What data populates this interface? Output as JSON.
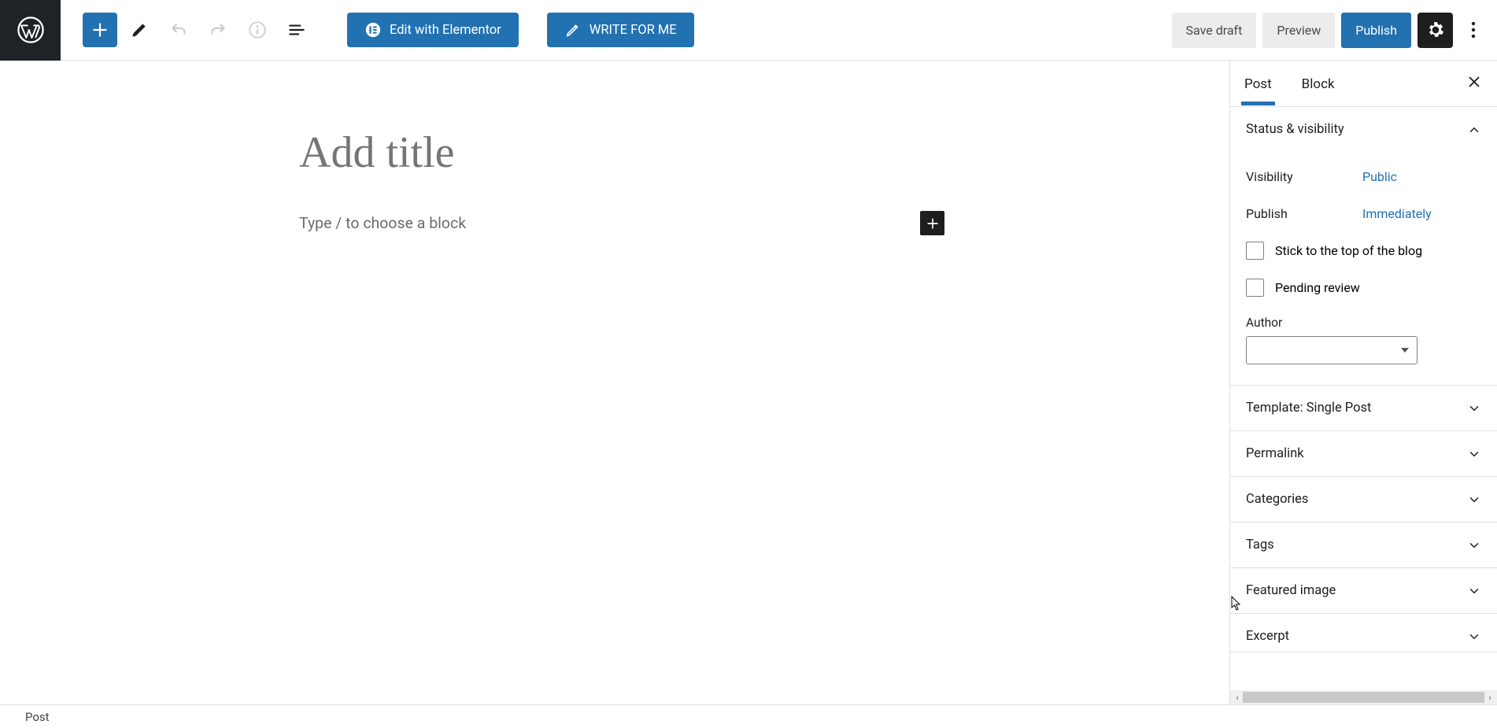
{
  "toolbar": {
    "edit_elementor": "Edit with Elementor",
    "write_for_me": "WRITE FOR ME",
    "save_draft": "Save draft",
    "preview": "Preview",
    "publish": "Publish"
  },
  "editor": {
    "title_placeholder": "Add title",
    "block_prompt": "Type / to choose a block"
  },
  "sidebar": {
    "tabs": {
      "post": "Post",
      "block": "Block"
    },
    "panels": {
      "status": {
        "title": "Status & visibility",
        "visibility_label": "Visibility",
        "visibility_value": "Public",
        "publish_label": "Publish",
        "publish_value": "Immediately",
        "stick_top": "Stick to the top of the blog",
        "pending": "Pending review",
        "author_label": "Author"
      },
      "template": "Template: Single Post",
      "permalink": "Permalink",
      "categories": "Categories",
      "tags": "Tags",
      "featured": "Featured image",
      "excerpt": "Excerpt"
    }
  },
  "footer": {
    "breadcrumb": "Post"
  }
}
